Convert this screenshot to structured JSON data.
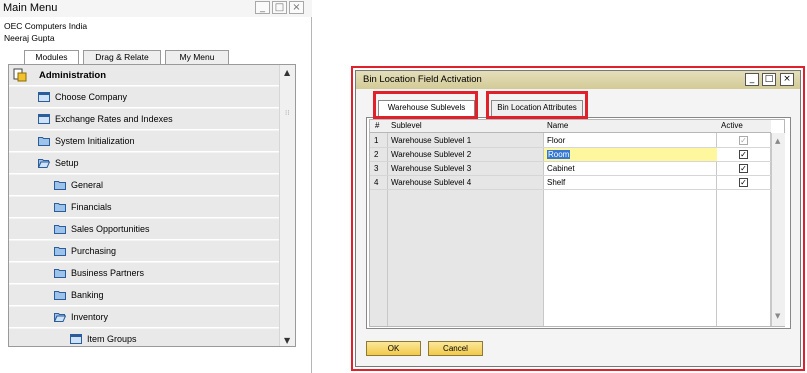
{
  "main_menu": {
    "title": "Main Menu",
    "company": "OEC Computers India",
    "user": "Neeraj Gupta",
    "window_buttons": {
      "minimize": "_",
      "maximize": "□",
      "close": "×"
    },
    "tabs": [
      "Modules",
      "Drag & Relate",
      "My Menu"
    ],
    "items": [
      {
        "label": "Administration",
        "icon": "administration-icon"
      },
      {
        "label": "Choose Company",
        "icon": "window-icon"
      },
      {
        "label": "Exchange Rates and Indexes",
        "icon": "window-icon"
      },
      {
        "label": "System Initialization",
        "icon": "folder-icon"
      },
      {
        "label": "Setup",
        "icon": "folder-open-icon"
      },
      {
        "label": "General",
        "icon": "folder-icon"
      },
      {
        "label": "Financials",
        "icon": "folder-icon"
      },
      {
        "label": "Sales Opportunities",
        "icon": "folder-icon"
      },
      {
        "label": "Purchasing",
        "icon": "folder-icon"
      },
      {
        "label": "Business Partners",
        "icon": "folder-icon"
      },
      {
        "label": "Banking",
        "icon": "folder-icon"
      },
      {
        "label": "Inventory",
        "icon": "folder-open-icon"
      },
      {
        "label": "Item Groups",
        "icon": "window-icon"
      }
    ]
  },
  "dialog": {
    "title": "Bin Location Field Activation",
    "window_buttons": {
      "minimize": "_",
      "maximize": "□",
      "close": "×"
    },
    "tabs": [
      "Warehouse Sublevels",
      "Bin Location Attributes"
    ],
    "columns": [
      "#",
      "Sublevel",
      "Name",
      "Active"
    ],
    "rows": [
      {
        "num": "1",
        "sublevel": "Warehouse Sublevel 1",
        "name": "Floor",
        "active": true,
        "active_enabled": false
      },
      {
        "num": "2",
        "sublevel": "Warehouse Sublevel 2",
        "name": "Room",
        "active": true,
        "active_enabled": true
      },
      {
        "num": "3",
        "sublevel": "Warehouse Sublevel 3",
        "name": "Cabinet",
        "active": true,
        "active_enabled": true
      },
      {
        "num": "4",
        "sublevel": "Warehouse Sublevel 4",
        "name": "Shelf",
        "active": true,
        "active_enabled": true
      }
    ],
    "ok_label": "OK",
    "cancel_label": "Cancel"
  },
  "colors": {
    "highlight_red": "#e0202b",
    "selected_cell": "#fff79e",
    "button_gold": "#f2c94b",
    "title_bar": "#d3ca96"
  }
}
